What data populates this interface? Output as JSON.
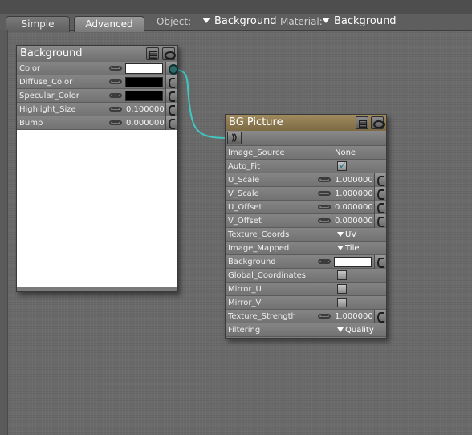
{
  "tabs": {
    "simple": "Simple",
    "advanced": "Advanced"
  },
  "selectors": {
    "object_label": "Object:",
    "object_value": "Background",
    "material_label": "Material:",
    "material_value": "Background"
  },
  "bg_node": {
    "title": "Background",
    "rows": {
      "color": "Color",
      "diffuse": "Diffuse_Color",
      "specular": "Specular_Color",
      "highlight": "Highlight_Size",
      "highlight_value": "0.100000",
      "bump": "Bump",
      "bump_value": "0.000000"
    }
  },
  "bgp_node": {
    "title": "BG Picture",
    "rows": {
      "image_source": "Image_Source",
      "image_source_value": "None",
      "auto_fit": "Auto_Fit",
      "u_scale": "U_Scale",
      "u_scale_value": "1.000000",
      "v_scale": "V_Scale",
      "v_scale_value": "1.000000",
      "u_offset": "U_Offset",
      "u_offset_value": "0.000000",
      "v_offset": "V_Offset",
      "v_offset_value": "0.000000",
      "texture_coords": "Texture_Coords",
      "texture_coords_value": "UV",
      "image_mapped": "Image_Mapped",
      "image_mapped_value": "Tile",
      "background": "Background",
      "global_coords": "Global_Coordinates",
      "mirror_u": "Mirror_U",
      "mirror_v": "Mirror_V",
      "texture_strength": "Texture_Strength",
      "texture_strength_value": "1.000000",
      "filtering": "Filtering",
      "filtering_value": "Quality"
    }
  },
  "colors": {
    "wire": "#3fc7c1",
    "bgp_title": "#8f7a50",
    "checkbox_mark": "#117d8a"
  }
}
